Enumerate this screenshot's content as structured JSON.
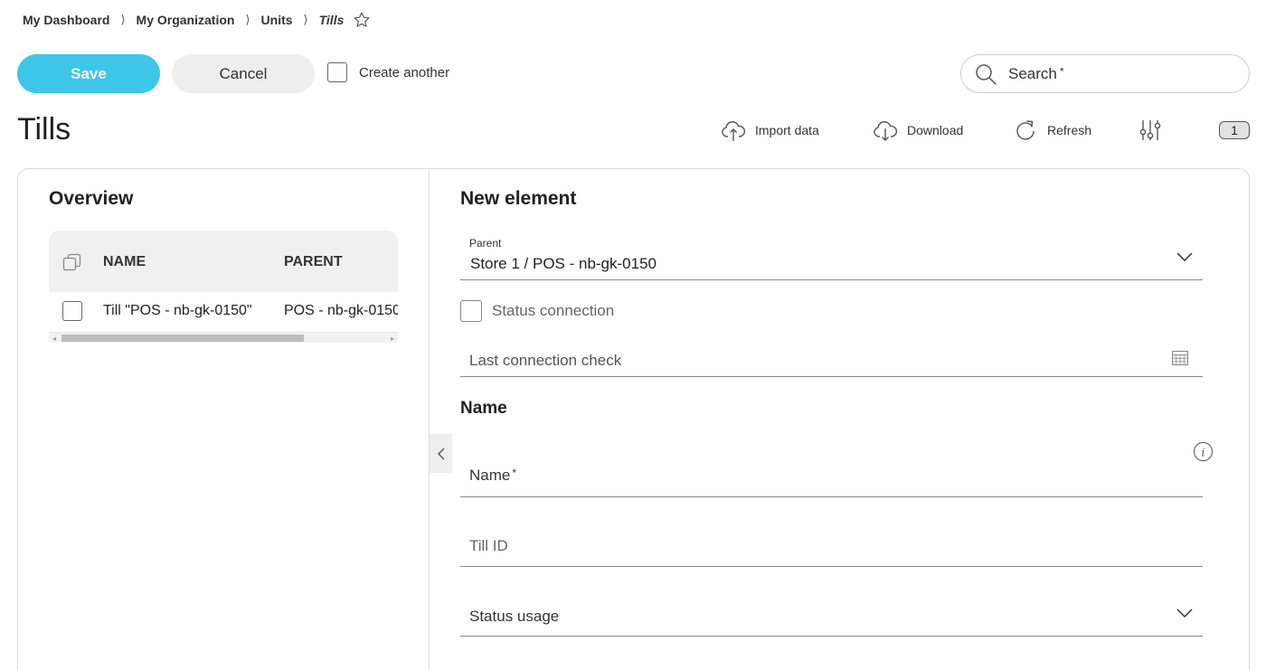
{
  "breadcrumb": {
    "items": [
      "My Dashboard",
      "My Organization",
      "Units"
    ],
    "current": "Tills",
    "separator": "⟩"
  },
  "toolbar": {
    "save_label": "Save",
    "cancel_label": "Cancel",
    "create_another_label": "Create another",
    "create_another_checked": false
  },
  "search": {
    "placeholder": "Search",
    "required_mark": "*"
  },
  "page": {
    "title": "Tills"
  },
  "actions": {
    "import_label": "Import data",
    "download_label": "Download",
    "refresh_label": "Refresh",
    "count": "1"
  },
  "overview": {
    "title": "Overview",
    "columns": [
      "NAME",
      "PARENT"
    ],
    "rows": [
      {
        "name": "Till \"POS - nb-gk-0150\"",
        "parent": "POS - nb-gk-0150"
      }
    ]
  },
  "form": {
    "title": "New element",
    "parent_label": "Parent",
    "parent_value": "Store 1 / POS - nb-gk-0150",
    "status_connection_label": "Status connection",
    "last_connection_check_placeholder": "Last connection check",
    "name_section_title": "Name",
    "name_placeholder": "Name",
    "name_required_mark": "*",
    "till_id_placeholder": "Till ID",
    "status_usage_placeholder": "Status usage"
  },
  "colors": {
    "accent": "#3ec6e8",
    "button_secondary": "#eeeeee",
    "table_header": "#f0f0f0"
  },
  "icons": [
    "star-icon",
    "search-icon",
    "upload-cloud-icon",
    "download-cloud-icon",
    "refresh-icon",
    "filter-sliders-icon",
    "copy-icon",
    "chevron-down-icon",
    "calendar-icon",
    "info-icon",
    "chevron-left-icon"
  ]
}
